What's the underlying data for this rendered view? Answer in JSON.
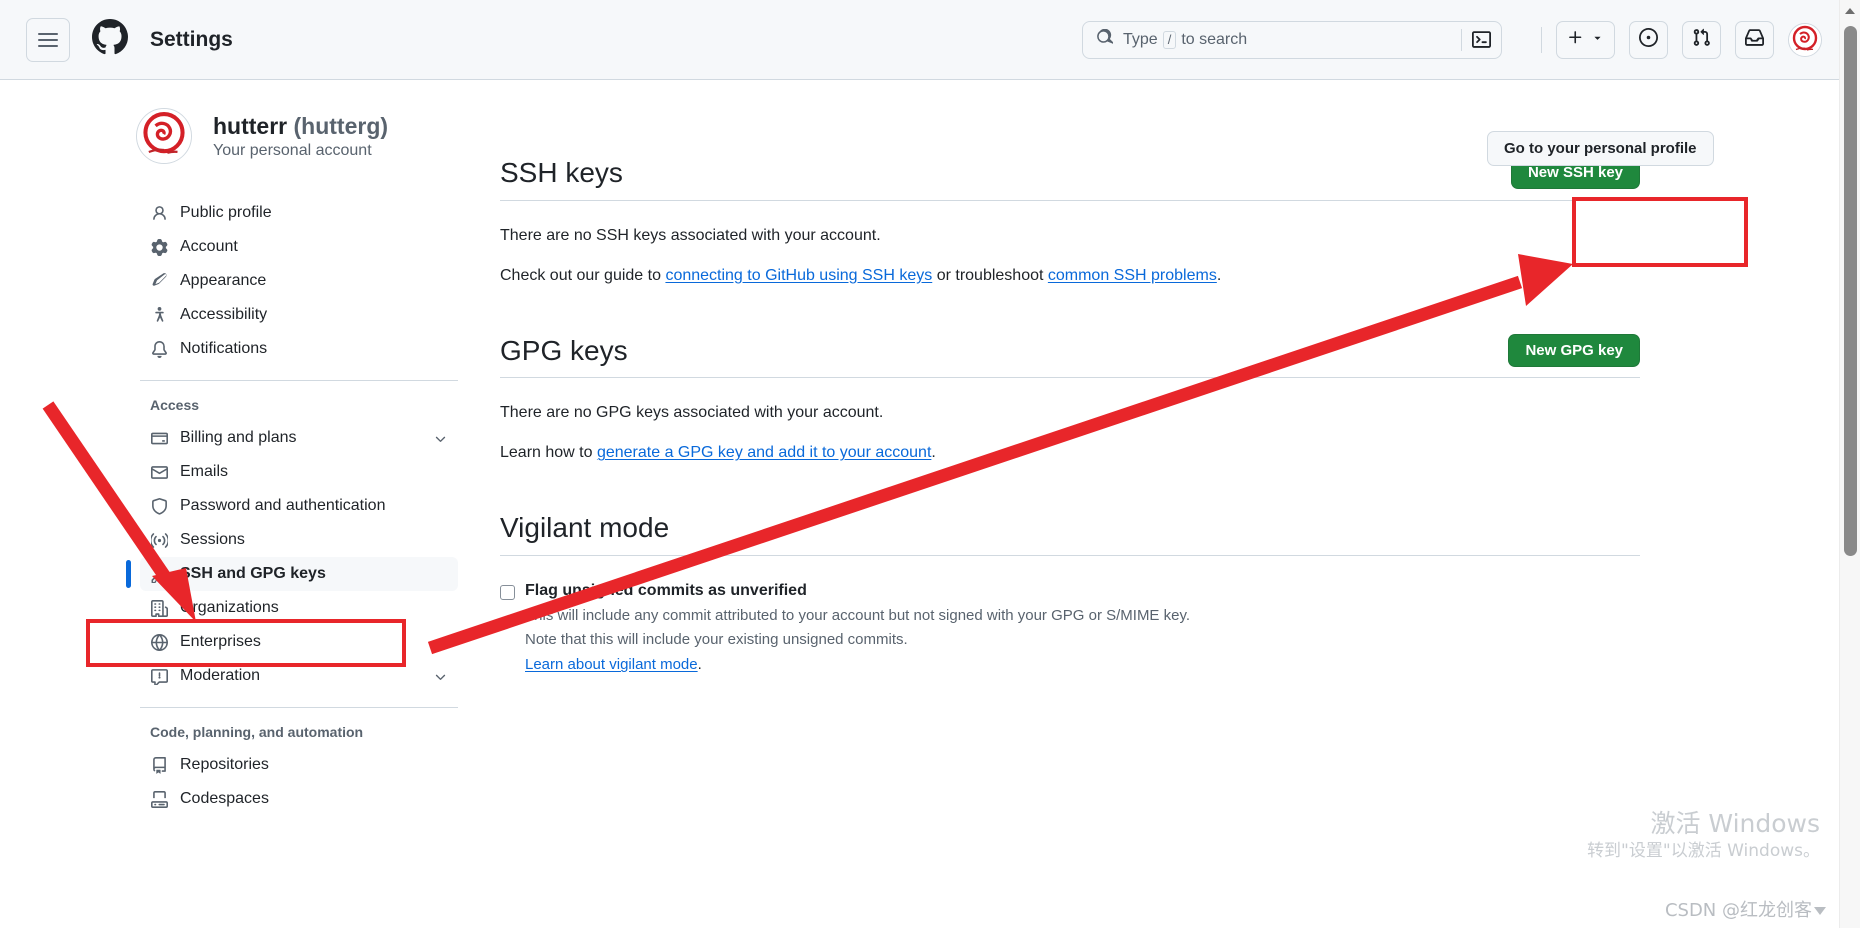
{
  "header": {
    "title": "Settings",
    "hamburger_icon": "hamburger-menu-icon",
    "logo_icon": "github-logo-icon",
    "search": {
      "placeholder_prefix": "Type",
      "slash_key": "/",
      "placeholder_suffix": "to search",
      "search_icon": "search-icon",
      "terminal_icon": "terminal-icon"
    },
    "actions": [
      {
        "name": "create-new-button",
        "icon": "plus-icon",
        "chevron": "chevron-down-icon"
      },
      {
        "name": "issues-button",
        "icon": "issue-opened-icon"
      },
      {
        "name": "pull-requests-button",
        "icon": "git-pull-request-icon"
      },
      {
        "name": "notifications-button",
        "icon": "inbox-icon"
      },
      {
        "name": "account-avatar",
        "icon": "user-avatar-icon"
      }
    ]
  },
  "profile": {
    "name": "hutterr",
    "handle": "(hutterg)",
    "subtitle": "Your personal account",
    "avatar_icon": "user-avatar-icon"
  },
  "personal_profile_button": "Go to your personal profile",
  "sidebar": {
    "groups": [
      {
        "title": "",
        "items": [
          {
            "label": "Public profile",
            "icon": "person-icon",
            "selected": false,
            "chevron": false
          },
          {
            "label": "Account",
            "icon": "gear-icon",
            "selected": false,
            "chevron": false
          },
          {
            "label": "Appearance",
            "icon": "paintbrush-icon",
            "selected": false,
            "chevron": false
          },
          {
            "label": "Accessibility",
            "icon": "accessibility-icon",
            "selected": false,
            "chevron": false
          },
          {
            "label": "Notifications",
            "icon": "bell-icon",
            "selected": false,
            "chevron": false
          }
        ]
      },
      {
        "title": "Access",
        "items": [
          {
            "label": "Billing and plans",
            "icon": "credit-card-icon",
            "selected": false,
            "chevron": true
          },
          {
            "label": "Emails",
            "icon": "mail-icon",
            "selected": false,
            "chevron": false
          },
          {
            "label": "Password and authentication",
            "icon": "shield-lock-icon",
            "selected": false,
            "chevron": false
          },
          {
            "label": "Sessions",
            "icon": "broadcast-icon",
            "selected": false,
            "chevron": false
          },
          {
            "label": "SSH and GPG keys",
            "icon": "key-icon",
            "selected": true,
            "chevron": false
          },
          {
            "label": "Organizations",
            "icon": "organization-icon",
            "selected": false,
            "chevron": false
          },
          {
            "label": "Enterprises",
            "icon": "globe-icon",
            "selected": false,
            "chevron": false
          },
          {
            "label": "Moderation",
            "icon": "report-icon",
            "selected": false,
            "chevron": true
          }
        ]
      },
      {
        "title": "Code, planning, and automation",
        "items": [
          {
            "label": "Repositories",
            "icon": "repo-icon",
            "selected": false,
            "chevron": false
          },
          {
            "label": "Codespaces",
            "icon": "codespaces-icon",
            "selected": false,
            "chevron": false
          }
        ]
      }
    ]
  },
  "main": {
    "ssh": {
      "title": "SSH keys",
      "button": "New SSH key",
      "empty_text": "There are no SSH keys associated with your account.",
      "guide_prefix": "Check out our guide to ",
      "guide_link_1": "connecting to GitHub using SSH keys",
      "guide_middle": " or troubleshoot ",
      "guide_link_2": "common SSH problems",
      "guide_suffix": "."
    },
    "gpg": {
      "title": "GPG keys",
      "button": "New GPG key",
      "empty_text": "There are no GPG keys associated with your account.",
      "learn_prefix": "Learn how to ",
      "learn_link": "generate a GPG key and add it to your account",
      "learn_suffix": "."
    },
    "vigilant": {
      "title": "Vigilant mode",
      "checkbox_label": "Flag unsigned commits as unverified",
      "checkbox_checked": false,
      "note_1": "This will include any commit attributed to your account but not signed with your GPG or S/MIME key.",
      "note_2": "Note that this will include your existing unsigned commits.",
      "link": "Learn about vigilant mode",
      "link_suffix": "."
    }
  },
  "annotations": {
    "highlight_color": "#e8262a",
    "boxes": [
      {
        "name": "ssh-gpg-keys-highlight"
      },
      {
        "name": "new-ssh-key-highlight"
      }
    ],
    "arrows": [
      {
        "name": "arrow-to-ssh-gpg-keys"
      },
      {
        "name": "arrow-to-new-ssh-key"
      }
    ]
  },
  "watermark": {
    "line1": "激活 Windows",
    "line2": "转到\"设置\"以激活 Windows。",
    "credit": "CSDN @红龙创客"
  },
  "colors": {
    "green_button": "#1f883d",
    "link_blue": "#0969da",
    "annotation_red": "#e8262a",
    "selected_bar": "#0969da"
  },
  "scrollbar": {
    "up_arrow_icon": "triangle-up-icon",
    "thumb": "scrollbar-thumb"
  }
}
